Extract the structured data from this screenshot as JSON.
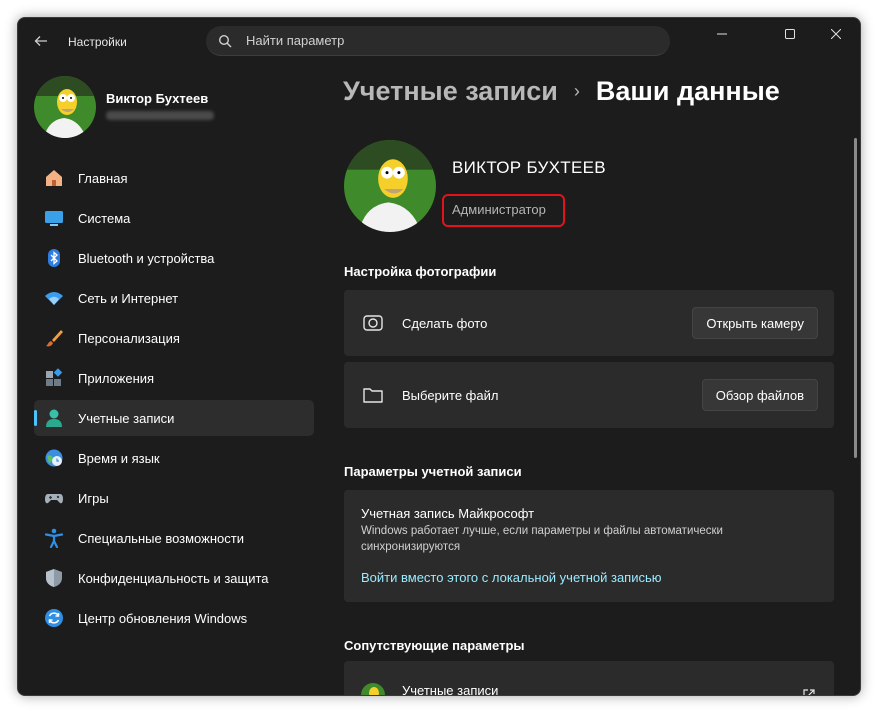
{
  "app": {
    "title": "Настройки"
  },
  "search": {
    "placeholder": "Найти параметр"
  },
  "user": {
    "name": "Виктор Бухтеев"
  },
  "sidebar": {
    "items": [
      {
        "label": "Главная",
        "icon": "home-icon"
      },
      {
        "label": "Система",
        "icon": "system-icon"
      },
      {
        "label": "Bluetooth и устройства",
        "icon": "bluetooth-icon"
      },
      {
        "label": "Сеть и Интернет",
        "icon": "wifi-icon"
      },
      {
        "label": "Персонализация",
        "icon": "brush-icon"
      },
      {
        "label": "Приложения",
        "icon": "apps-icon"
      },
      {
        "label": "Учетные записи",
        "icon": "accounts-icon",
        "active": true
      },
      {
        "label": "Время и язык",
        "icon": "time-language-icon"
      },
      {
        "label": "Игры",
        "icon": "gamepad-icon"
      },
      {
        "label": "Специальные возможности",
        "icon": "accessibility-icon"
      },
      {
        "label": "Конфиденциальность и защита",
        "icon": "shield-icon"
      },
      {
        "label": "Центр обновления Windows",
        "icon": "update-icon"
      }
    ]
  },
  "breadcrumb": {
    "parent": "Учетные записи",
    "separator": "›",
    "current": "Ваши данные"
  },
  "profile": {
    "name": "ВИКТОР БУХТЕЕВ",
    "role": "Администратор"
  },
  "photo_section": {
    "title": "Настройка фотографии",
    "take_photo": {
      "label": "Сделать фото",
      "button": "Открыть камеру"
    },
    "choose_file": {
      "label": "Выберите файл",
      "button": "Обзор файлов"
    }
  },
  "account_section": {
    "title": "Параметры учетной записи",
    "microsoft": {
      "title": "Учетная запись Майкрософт",
      "description": "Windows работает лучше, если параметры и файлы автоматически синхронизируются",
      "link": "Войти вместо этого с локальной учетной записью"
    }
  },
  "related_section": {
    "title": "Сопутствующие параметры",
    "item": {
      "label": "Учетные записи"
    }
  },
  "colors": {
    "accent": "#4cc2ff",
    "highlight": "#e5121b",
    "link": "#99ebff",
    "background": "#1c1c1c",
    "card": "#2b2b2b"
  }
}
